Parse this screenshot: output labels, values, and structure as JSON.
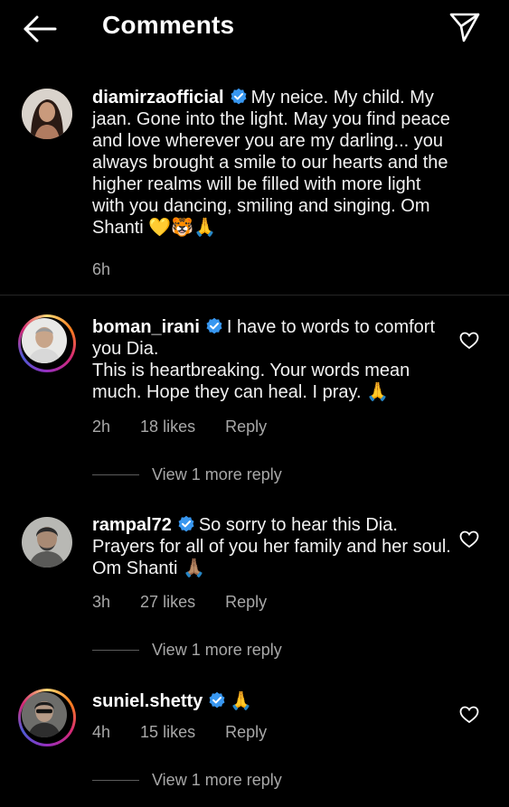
{
  "header": {
    "title": "Comments"
  },
  "icons": {
    "back": "back-arrow-icon",
    "share": "paper-plane-icon",
    "like": "heart-icon",
    "verified": "verified-badge-icon"
  },
  "colors": {
    "background": "#000000",
    "verified": "#3897f0",
    "muted": "#a8a8a8"
  },
  "comments": [
    {
      "username": "diamirzaofficial",
      "text": "My neice. My child. My jaan. Gone into the light. May you find peace and love wherever you are my darling... you always brought a smile to our hearts and the higher realms will be filled with more light with you dancing, smiling and singing. Om Shanti 💛🐯🙏",
      "time": "6h"
    },
    {
      "username": "boman_irani",
      "text_line1": "I have to words to comfort you Dia.",
      "text_line2": "This is heartbreaking. Your words mean much. Hope they can heal. I pray. 🙏",
      "time": "2h",
      "likes": "18 likes",
      "reply": "Reply",
      "more_replies": "View 1 more reply"
    },
    {
      "username": "rampal72",
      "text": "So sorry to hear this Dia. Prayers for all of you her family and her soul. Om Shanti 🙏🏽",
      "time": "3h",
      "likes": "27 likes",
      "reply": "Reply",
      "more_replies": "View 1 more reply"
    },
    {
      "username": "suniel.shetty",
      "text": "🙏",
      "time": "4h",
      "likes": "15 likes",
      "reply": "Reply",
      "more_replies": "View 1 more reply"
    }
  ]
}
